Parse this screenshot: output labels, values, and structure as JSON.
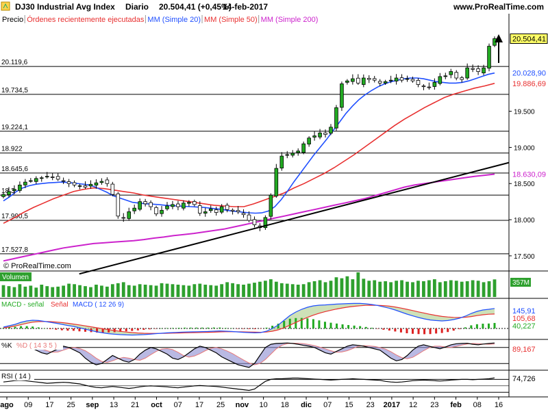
{
  "window": {
    "title": "DJ30 Industrial Avg Index",
    "period": "Diario",
    "quote": "20.504,41 (+0,45%)",
    "date": "14-feb-2017",
    "url": "www.ProRealTime.com",
    "watermark": "© ProRealTime.com"
  },
  "colors": {
    "up_candle": "#22aa22",
    "down_candle": "#ffffff",
    "mm20": "#1f4fff",
    "mm50": "#e83030",
    "mm200": "#cc22cc",
    "trendline": "#000000",
    "volume": "#2ea02e",
    "price_tag": "#ffff66"
  },
  "chart_data": [
    {
      "type": "candlestick",
      "legend": [
        {
          "label": "Precio",
          "color": "#000000"
        },
        {
          "label": "Órdenes recientemente ejecutadas",
          "color": "#e83030"
        },
        {
          "label": "MM (Simple 20)",
          "color": "#1f4fff"
        },
        {
          "label": "MM (Simple 50)",
          "color": "#e83030"
        },
        {
          "label": "MM (Simple 200)",
          "color": "#cc22cc"
        }
      ],
      "ylim": [
        17300,
        20850
      ],
      "y_ticks": [
        "17.500",
        "18.000",
        "18.500",
        "19.000",
        "19.500"
      ],
      "horizontal_levels": [
        "20.119,6",
        "19.734,5",
        "19.224,1",
        "18.922",
        "18.645,6",
        "18.3",
        "17.990,5",
        "17.527,8"
      ],
      "horizontal_values": [
        20119.6,
        19734.5,
        19224.1,
        18922,
        18645.6,
        18340,
        17990.5,
        17527.8
      ],
      "price_tags": [
        {
          "label": "20.504,41",
          "value": 20504.41,
          "kind": "last"
        },
        {
          "label": "20.028,90",
          "value": 20028.9,
          "kind": "mm20"
        },
        {
          "label": "19.886,69",
          "value": 19886.69,
          "kind": "mm50"
        },
        {
          "label": "18.630,09",
          "value": 18630.09,
          "kind": "mm200"
        }
      ],
      "x_labels": [
        "ago",
        "09",
        "17",
        "25",
        "sep",
        "13",
        "21",
        "oct",
        "07",
        "17",
        "25",
        "nov",
        "10",
        "18",
        "dic",
        "07",
        "15",
        "23",
        "2017",
        "12",
        "23",
        "feb",
        "08",
        "16"
      ],
      "closes": [
        18350,
        18390,
        18420,
        18480,
        18520,
        18540,
        18570,
        18580,
        18600,
        18590,
        18560,
        18530,
        18500,
        18480,
        18470,
        18450,
        18490,
        18510,
        18530,
        18500,
        18350,
        18050,
        18020,
        18110,
        18160,
        18250,
        18220,
        18180,
        18080,
        18130,
        18190,
        18210,
        18180,
        18230,
        18240,
        18210,
        18090,
        18110,
        18150,
        18100,
        18180,
        18140,
        18120,
        18110,
        18070,
        17990,
        17930,
        17890,
        18030,
        18340,
        18710,
        18880,
        18900,
        18920,
        18950,
        19050,
        19130,
        19160,
        19200,
        19180,
        19280,
        19550,
        19880,
        19920,
        19950,
        19890,
        19960,
        19940,
        19930,
        19890,
        19910,
        19930,
        19960,
        19930,
        19950,
        19920,
        19870,
        19840,
        19830,
        19900,
        19980,
        19990,
        20050,
        19960,
        19940,
        20100,
        20080,
        20050,
        20100,
        20400,
        20504.41
      ],
      "mm20": [
        18260,
        18320,
        18390,
        18440,
        18470,
        18490,
        18500,
        18510,
        18515,
        18520,
        18515,
        18505,
        18495,
        18485,
        18460,
        18420,
        18380,
        18330,
        18300,
        18270,
        18240,
        18230,
        18220,
        18215,
        18210,
        18200,
        18195,
        18190,
        18185,
        18180,
        18175,
        18170,
        18160,
        18150,
        18140,
        18125,
        18115,
        18105,
        18095,
        18090,
        18095,
        18120,
        18180,
        18280,
        18400,
        18530,
        18650,
        18770,
        18890,
        19000,
        19110,
        19230,
        19350,
        19470,
        19570,
        19660,
        19730,
        19790,
        19840,
        19880,
        19910,
        19930,
        19950,
        19960,
        19960,
        19950,
        19930,
        19910,
        19900,
        19890,
        19890,
        19900,
        19920,
        19950,
        19980,
        20010,
        20028.9
      ],
      "mm50": [
        17950,
        18020,
        18100,
        18170,
        18230,
        18290,
        18340,
        18390,
        18420,
        18440,
        18430,
        18410,
        18390,
        18370,
        18340,
        18320,
        18300,
        18280,
        18260,
        18240,
        18220,
        18200,
        18190,
        18180,
        18180,
        18220,
        18270,
        18320,
        18370,
        18440,
        18500,
        18570,
        18640,
        18720,
        18810,
        18900,
        19000,
        19100,
        19200,
        19300,
        19390,
        19470,
        19550,
        19620,
        19690,
        19740,
        19780,
        19820,
        19850,
        19886.69
      ],
      "mm200": [
        17430,
        17460,
        17490,
        17520,
        17550,
        17580,
        17610,
        17630,
        17650,
        17670,
        17680,
        17690,
        17700,
        17710,
        17725,
        17745,
        17760,
        17780,
        17795,
        17810,
        17830,
        17850,
        17870,
        17900,
        17930,
        17960,
        17990,
        18020,
        18050,
        18080,
        18110,
        18140,
        18170,
        18200,
        18230,
        18260,
        18290,
        18330,
        18370,
        18410,
        18450,
        18480,
        18500,
        18520,
        18540,
        18560,
        18580,
        18600,
        18615,
        18630.09
      ],
      "trendline": {
        "x0": 0.15,
        "y0": 17250,
        "x1": 1.0,
        "y1": 18790
      }
    },
    {
      "type": "bar",
      "title": "Volumen",
      "value_label": "357M",
      "values": [
        240,
        220,
        200,
        260,
        210,
        230,
        190,
        250,
        220,
        200,
        210,
        230,
        270,
        260,
        240,
        220,
        200,
        250,
        230,
        210,
        260,
        280,
        300,
        240,
        230,
        260,
        250,
        240,
        230,
        280,
        270,
        260,
        250,
        240,
        230,
        260,
        270,
        250,
        240,
        230,
        260,
        300,
        280,
        260,
        250,
        270,
        290,
        310,
        330,
        360,
        310,
        280,
        270,
        260,
        250,
        260,
        300,
        320,
        340,
        300,
        330,
        400,
        380,
        420,
        360,
        500,
        370,
        330,
        340,
        310,
        320,
        300,
        330,
        340,
        310,
        300,
        330,
        320,
        340,
        360,
        300,
        320,
        340,
        330,
        310,
        320,
        340,
        330,
        300,
        320,
        357
      ]
    },
    {
      "type": "histogram",
      "title": "MACD",
      "legend": [
        "MACD - señal",
        "Señal",
        "MACD ( 12 26 9)"
      ],
      "tags": [
        "145,91",
        "105,68",
        "40,227"
      ],
      "macd": [
        10,
        20,
        30,
        45,
        55,
        60,
        58,
        52,
        45,
        38,
        30,
        22,
        15,
        5,
        -5,
        -15,
        -25,
        -32,
        -38,
        -42,
        -45,
        -47,
        -48,
        -47,
        -45,
        -42,
        -38,
        -35,
        -32,
        -30,
        -28,
        -26,
        -25,
        -24,
        -23,
        -22,
        -20,
        -18,
        -20,
        -22,
        -25,
        -28,
        -30,
        -32,
        -30,
        -20,
        0,
        25,
        60,
        95,
        120,
        140,
        155,
        165,
        170,
        172,
        175,
        178,
        180,
        182,
        183,
        183,
        180,
        175,
        168,
        158,
        148,
        135,
        120,
        105,
        92,
        80,
        70,
        62,
        58,
        55,
        58,
        65,
        75,
        90,
        110,
        125,
        135,
        140,
        145.91
      ],
      "signal": [
        5,
        10,
        18,
        28,
        38,
        46,
        50,
        51,
        50,
        47,
        43,
        38,
        32,
        26,
        19,
        12,
        5,
        -2,
        -9,
        -15,
        -21,
        -26,
        -30,
        -33,
        -35,
        -36,
        -36,
        -36,
        -35,
        -34,
        -33,
        -32,
        -31,
        -30,
        -29,
        -28,
        -27,
        -25,
        -24,
        -24,
        -24,
        -25,
        -26,
        -27,
        -28,
        -26,
        -20,
        -10,
        5,
        24,
        44,
        63,
        81,
        97,
        111,
        123,
        133,
        142,
        150,
        157,
        162,
        166,
        169,
        170,
        169,
        167,
        163,
        157,
        149,
        140,
        131,
        121,
        112,
        103,
        95,
        88,
        84,
        81,
        80,
        82,
        87,
        94,
        100,
        104,
        105.68
      ]
    },
    {
      "type": "line",
      "title": "%K",
      "legend": [
        "%K",
        "%D ( 14 3 5 )"
      ],
      "tags": [
        "89,167"
      ],
      "k": [
        80,
        85,
        90,
        92,
        88,
        80,
        70,
        60,
        55,
        65,
        75,
        85,
        80,
        70,
        60,
        40,
        25,
        15,
        20,
        35,
        50,
        40,
        30,
        25,
        35,
        55,
        70,
        80,
        75,
        65,
        55,
        40,
        35,
        45,
        60,
        75,
        85,
        80,
        70,
        60,
        45,
        35,
        25,
        15,
        10,
        5,
        20,
        50,
        80,
        92,
        95,
        96,
        97,
        95,
        92,
        88,
        85,
        80,
        70,
        60,
        55,
        65,
        75,
        85,
        90,
        88,
        85,
        80,
        75,
        70,
        55,
        40,
        30,
        35,
        50,
        70,
        85,
        90,
        85,
        80,
        75,
        82,
        90,
        94,
        95,
        96,
        92,
        90,
        93,
        95,
        97
      ],
      "d": [
        75,
        80,
        84,
        87,
        89,
        87,
        82,
        75,
        68,
        62,
        63,
        70,
        77,
        80,
        76,
        68,
        55,
        40,
        28,
        24,
        30,
        38,
        43,
        40,
        35,
        32,
        40,
        53,
        65,
        74,
        76,
        72,
        62,
        50,
        44,
        48,
        57,
        68,
        77,
        80,
        75,
        67,
        57,
        45,
        33,
        22,
        15,
        20,
        35,
        55,
        75,
        88,
        94,
        96,
        96,
        94,
        91,
        87,
        81,
        75,
        68,
        62,
        63,
        68,
        76,
        84,
        87,
        86,
        84,
        80,
        74,
        64,
        52,
        42,
        38,
        43,
        55,
        68,
        79,
        85,
        85,
        82,
        80,
        84,
        89,
        93,
        95,
        94,
        93,
        92,
        93
      ]
    },
    {
      "type": "line",
      "title": "RSI",
      "legend": [
        "RSI ( 14 )"
      ],
      "tags": [
        "74,726"
      ],
      "values": [
        62,
        64,
        66,
        67,
        66,
        64,
        62,
        60,
        58,
        59,
        60,
        61,
        60,
        58,
        56,
        52,
        48,
        45,
        44,
        46,
        48,
        46,
        44,
        42,
        44,
        47,
        49,
        50,
        49,
        48,
        47,
        45,
        44,
        46,
        48,
        50,
        51,
        50,
        49,
        48,
        46,
        44,
        42,
        40,
        38,
        36,
        40,
        52,
        64,
        70,
        72,
        72,
        73,
        74,
        74,
        73,
        72,
        71,
        70,
        69,
        68,
        69,
        70,
        71,
        72,
        71,
        70,
        69,
        68,
        67,
        64,
        62,
        61,
        62,
        64,
        66,
        67,
        68,
        67,
        66,
        65,
        66,
        68,
        69,
        70,
        70,
        69,
        70,
        71,
        72,
        74.726
      ]
    }
  ]
}
